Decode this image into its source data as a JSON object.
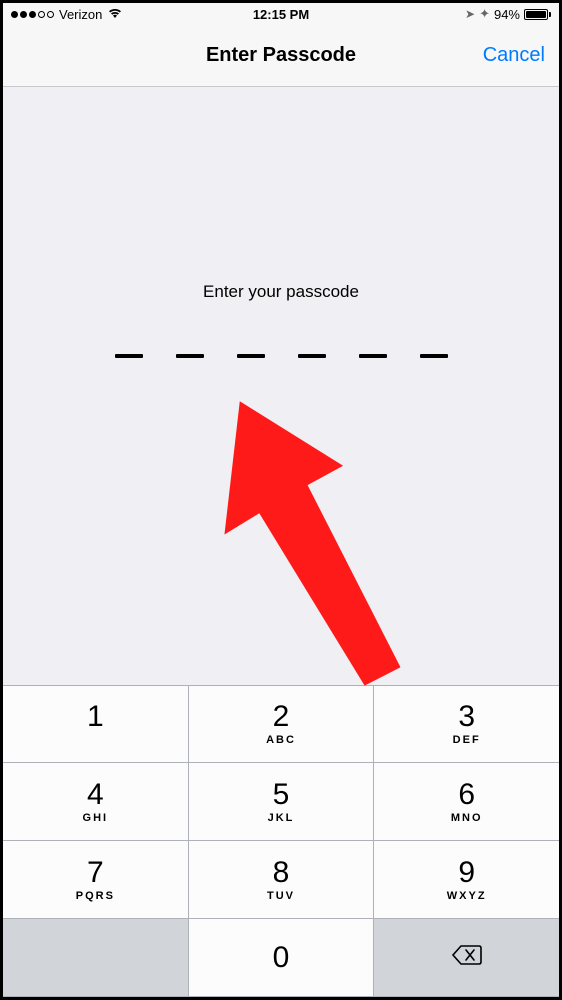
{
  "statusBar": {
    "carrier": "Verizon",
    "time": "12:15 PM",
    "battery": "94%"
  },
  "navBar": {
    "title": "Enter Passcode",
    "cancel": "Cancel"
  },
  "content": {
    "prompt": "Enter your passcode",
    "dashCount": 6
  },
  "keypad": {
    "keys": [
      [
        {
          "num": "1",
          "letters": ""
        },
        {
          "num": "2",
          "letters": "ABC"
        },
        {
          "num": "3",
          "letters": "DEF"
        }
      ],
      [
        {
          "num": "4",
          "letters": "GHI"
        },
        {
          "num": "5",
          "letters": "JKL"
        },
        {
          "num": "6",
          "letters": "MNO"
        }
      ],
      [
        {
          "num": "7",
          "letters": "PQRS"
        },
        {
          "num": "8",
          "letters": "TUV"
        },
        {
          "num": "9",
          "letters": "WXYZ"
        }
      ],
      [
        {
          "blank": true
        },
        {
          "num": "0",
          "letters": ""
        },
        {
          "backspace": true
        }
      ]
    ]
  }
}
